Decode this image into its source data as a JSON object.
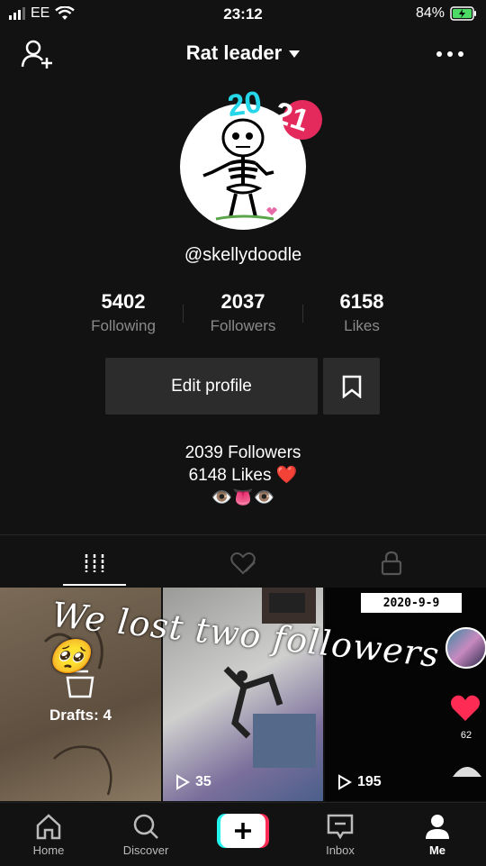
{
  "status": {
    "carrier": "EE",
    "time": "23:12",
    "battery": "84%"
  },
  "header": {
    "title": "Rat leader"
  },
  "profile": {
    "avatar_badge": "2021",
    "username": "@skellydoodle",
    "stats": [
      {
        "value": "5402",
        "label": "Following"
      },
      {
        "value": "2037",
        "label": "Followers"
      },
      {
        "value": "6158",
        "label": "Likes"
      }
    ],
    "edit_label": "Edit profile",
    "bio_lines": [
      "2039 Followers",
      "6148 Likes ❤️",
      "👁️👅👁️"
    ]
  },
  "grid": {
    "overlay_text": "We lost two followers 🥺",
    "drafts_label": "Drafts: 4",
    "videos": [
      {
        "views": "35"
      },
      {
        "views": "195"
      }
    ],
    "video3_date": "2020-9-9",
    "video3_likes": "62"
  },
  "nav": [
    {
      "label": "Home",
      "icon": "home-icon"
    },
    {
      "label": "Discover",
      "icon": "search-icon"
    },
    {
      "label": "",
      "icon": "plus-icon"
    },
    {
      "label": "Inbox",
      "icon": "inbox-icon"
    },
    {
      "label": "Me",
      "icon": "person-icon"
    }
  ],
  "colors": {
    "background": "#121212",
    "button_bg": "#2c2c2c",
    "heart": "#fe2c55",
    "cyan": "#25f4ee"
  }
}
